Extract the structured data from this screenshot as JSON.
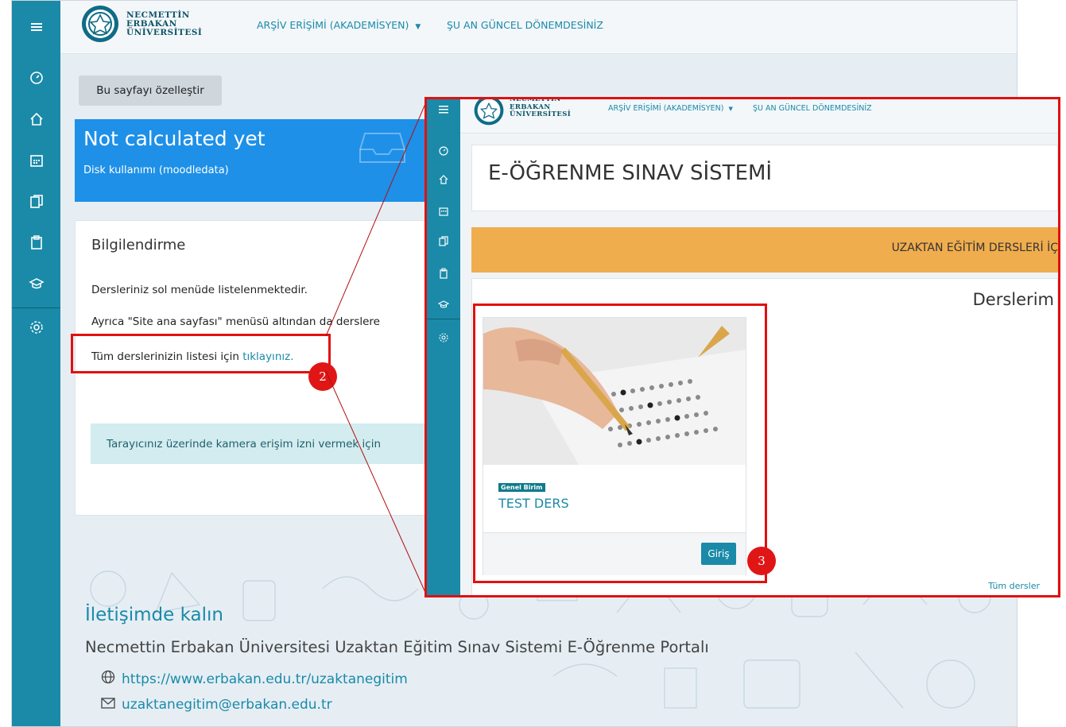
{
  "topbar": {
    "logo_line1": "NECMETTİN",
    "logo_line2": "ERBAKAN",
    "logo_line3": "ÜNİVERSİTESİ",
    "archive_link": "ARŞİV ERİŞİMİ (AKADEMİSYEN)",
    "period_link": "ŞU AN GÜNCEL DÖNEMDESİNİZ"
  },
  "sidebar": {
    "items": [
      "menu-icon",
      "dashboard-icon",
      "home-icon",
      "calendar-icon",
      "files-icon",
      "clipboard-icon",
      "graduation-cap-icon",
      "settings-icon"
    ]
  },
  "main": {
    "customize_button": "Bu sayfayı özelleştir",
    "disk_card": {
      "value": "Not calculated yet",
      "label": "Disk kullanımı (moodledata)"
    },
    "info_card": {
      "title": "Bilgilendirme",
      "line1": "Dersleriniz sol menüde listelenmektedir.",
      "line2": "Ayrıca \"Site ana sayfası\" menüsü altından da derslere",
      "line3_prefix": "Tüm derslerinizin listesi için ",
      "line3_link": "tıklayınız.",
      "alert": "Tarayıcınız üzerinde kamera erişim izni vermek için"
    }
  },
  "footer": {
    "title": "İletişimde kalın",
    "subtitle": "Necmettin Erbakan Üniversitesi Uzaktan Eğitim Sınav Sistemi E-Öğrenme Portalı",
    "website": "https://www.erbakan.edu.tr/uzaktanegitim",
    "email": "uzaktanegitim@erbakan.edu.tr"
  },
  "annotations": {
    "step2": "2",
    "step3": "3"
  },
  "inset": {
    "archive_link": "ARŞİV ERİŞİMİ (AKADEMİSYEN)",
    "period_link": "ŞU AN GÜNCEL DÖNEMDESİNİZ",
    "page_title": "E-ÖĞRENME SINAV SİSTEMİ",
    "banner": "UZAKTAN EĞİTİM DERSLERİ İÇ",
    "my_courses": "Derslerim",
    "course": {
      "category": "Genel Birim",
      "name": "TEST DERS",
      "enter_button": "Giriş"
    },
    "all_courses": "Tüm dersler"
  },
  "colors": {
    "accent": "#1a8aa8",
    "highlight": "#e11010",
    "disk_card": "#1e90e8",
    "banner": "#f0ad4e"
  }
}
